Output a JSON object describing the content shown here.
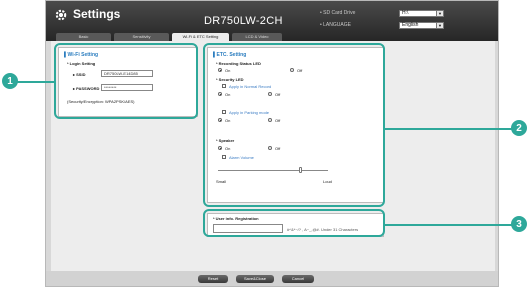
{
  "window": {
    "title": "Settings",
    "model": "DR750LW-2CH"
  },
  "top_fields": {
    "sd_label": "• SD Card Drive",
    "sd_value": "H:\\",
    "lang_label": "• LANGUAGE",
    "lang_value": "English"
  },
  "tabs": [
    {
      "label": "Basic"
    },
    {
      "label": "Sensitivity"
    },
    {
      "label": "Wi-Fi & ETC Setting"
    },
    {
      "label": "LCD & Video"
    }
  ],
  "wifi": {
    "heading": "Wi-Fi Setting",
    "login_label": "* Login Setting",
    "ssid_label": "SSID",
    "ssid_value": "DR750LW-E14D85",
    "password_label": "PASSWORD",
    "password_value": "********",
    "security_note": "(Security/Encryption: WPA2PSK/AES)"
  },
  "etc": {
    "heading": "ETC. Setting",
    "rec_led_label": "* Recording Status LED",
    "rec_led_on": "On",
    "rec_led_off": "Off",
    "sec_led_label": "* Security LED",
    "normal_rec_label": "Apply in Normal Record",
    "normal_on": "On",
    "normal_off": "Off",
    "parking_label": "Apply in Parking mode",
    "parking_on": "On",
    "parking_off": "Off",
    "speaker_label": "* Speaker",
    "speaker_on": "On",
    "speaker_off": "Off",
    "volume_label": "Alarm Volume",
    "volume_small": "Small",
    "volume_loud": "Loud",
    "volume_level": 0.75
  },
  "user_info": {
    "label": "* User info. Registration",
    "hint": "#^&*~/? , A~_,@#. Under 31 Characters"
  },
  "buttons": {
    "reset": "Reset",
    "save_close": "Save&Close",
    "cancel": "Cancel"
  },
  "callouts": [
    "1",
    "2",
    "3"
  ]
}
